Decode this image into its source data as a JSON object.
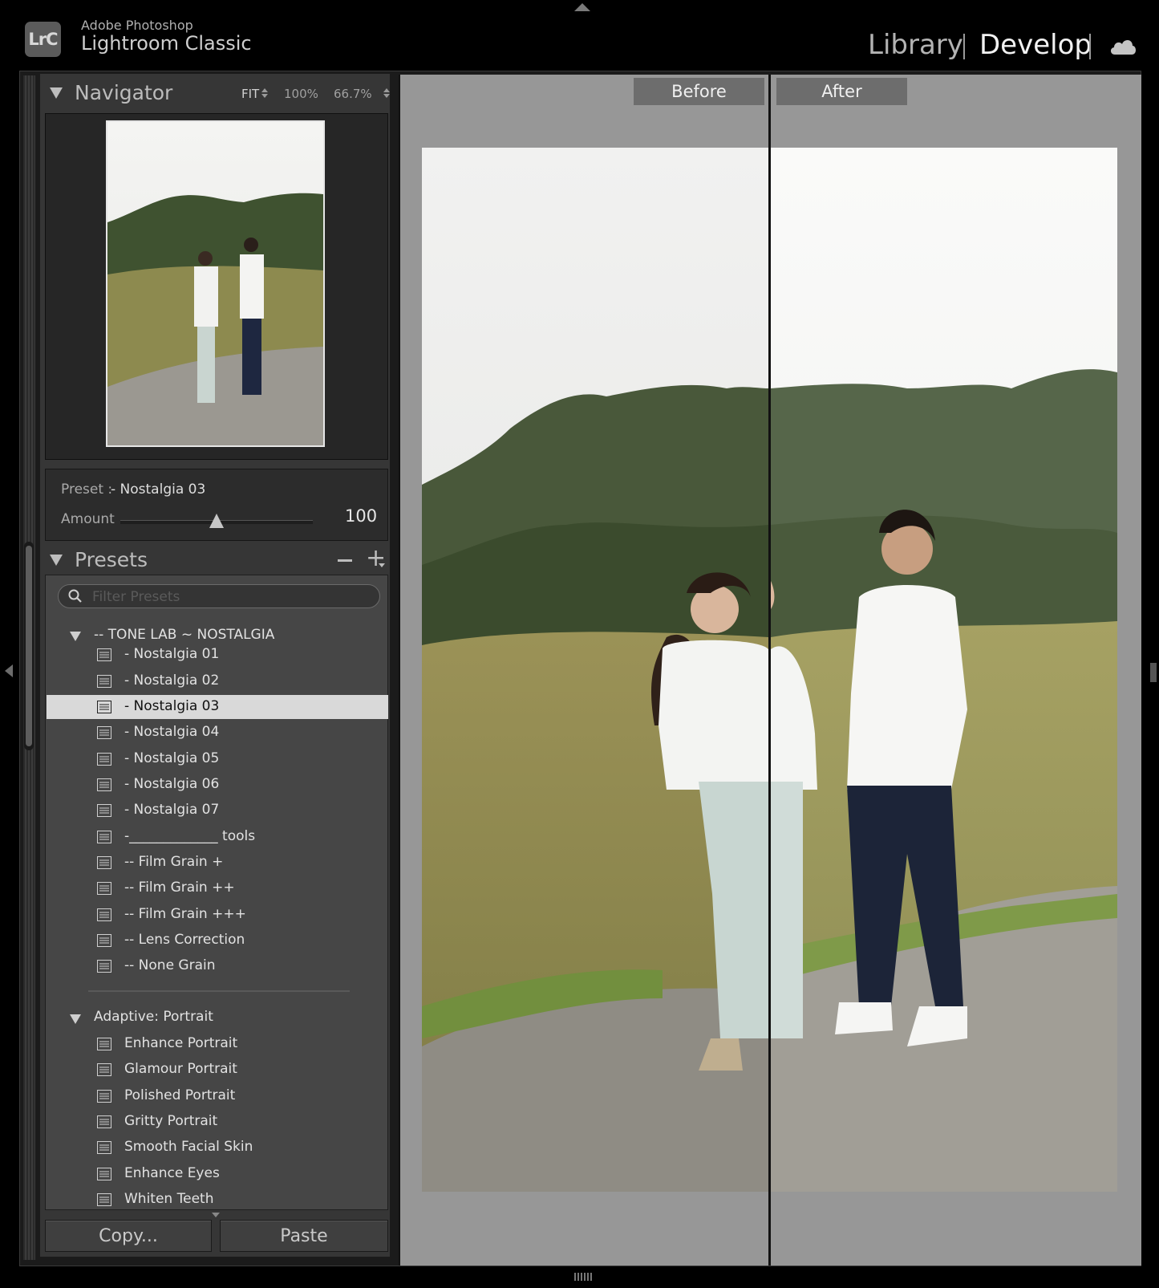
{
  "header": {
    "app_name_top": "Adobe Photoshop",
    "app_name_main": "Lightroom Classic",
    "logo_text": "LrC",
    "modules": [
      {
        "label": "Library",
        "active": false
      },
      {
        "label": "Develop",
        "active": true
      }
    ],
    "cloud_icon": "cloud-icon"
  },
  "navigator": {
    "title": "Navigator",
    "zoom_options": [
      "FIT",
      "100%",
      "66.7%"
    ]
  },
  "preset_amount": {
    "preset_label": "Preset :",
    "preset_name": "- Nostalgia 03",
    "amount_label": "Amount",
    "amount_value": "100",
    "amount_fraction": 0.5
  },
  "presets": {
    "title": "Presets",
    "filter_placeholder": "Filter Presets",
    "groups": [
      {
        "label": "-- TONE LAB ~ NOSTALGIA",
        "items": [
          "- Nostalgia 01",
          "- Nostalgia 02",
          "- Nostalgia 03",
          "- Nostalgia 04",
          "- Nostalgia 05",
          "- Nostalgia 06",
          "- Nostalgia 07",
          "-_____________ tools",
          "-- Film Grain +",
          "-- Film Grain ++",
          "-- Film Grain +++",
          "-- Lens Correction",
          "-- None Grain"
        ]
      },
      {
        "label": "Adaptive: Portrait",
        "items": [
          "Enhance Portrait",
          "Glamour Portrait",
          "Polished Portrait",
          "Gritty Portrait",
          "Smooth Facial Skin",
          "Enhance Eyes",
          "Whiten Teeth"
        ]
      }
    ],
    "selected_item": "- Nostalgia 03"
  },
  "actions": {
    "copy_label": "Copy...",
    "paste_label": "Paste"
  },
  "compare": {
    "before_label": "Before",
    "after_label": "After"
  }
}
